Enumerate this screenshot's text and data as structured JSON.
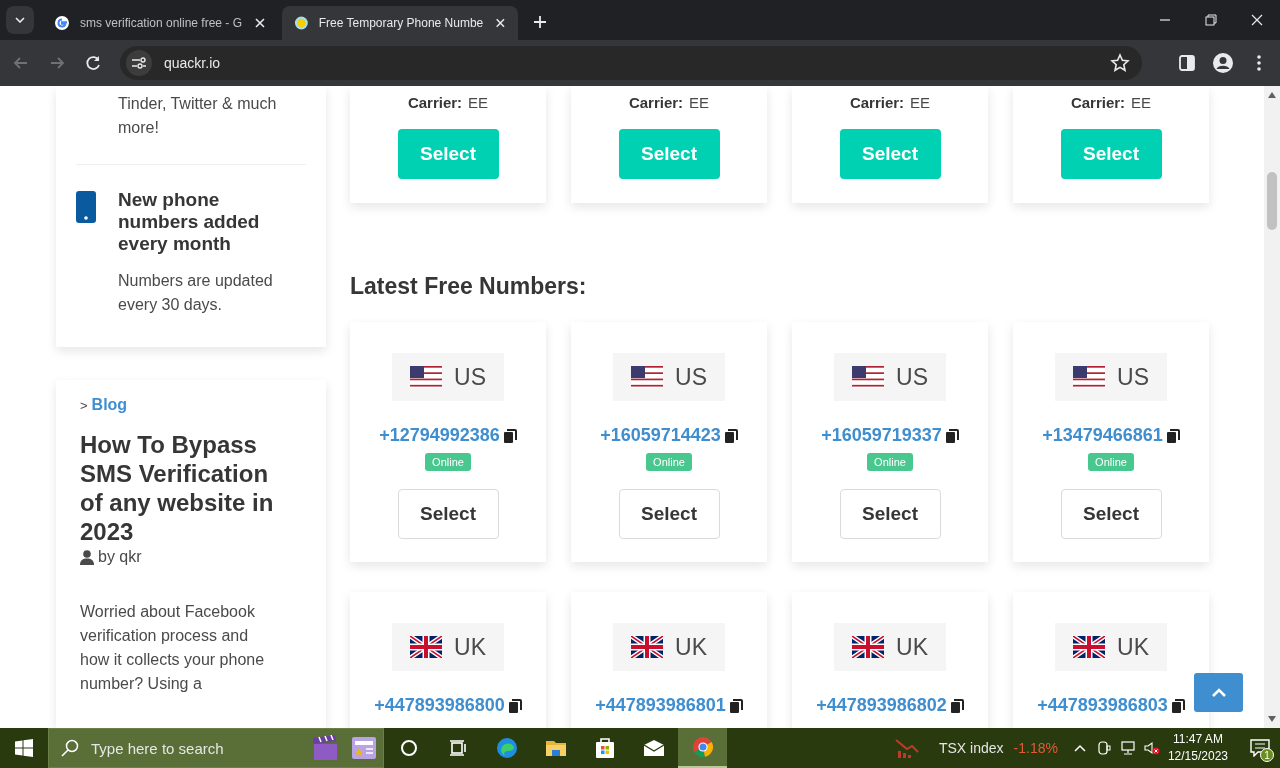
{
  "browser": {
    "tabs": [
      {
        "title": "sms verification online free - G",
        "kind": "google",
        "selected": false
      },
      {
        "title": "Free Temporary Phone Numbe",
        "kind": "duck",
        "selected": true
      }
    ],
    "address": "quackr.io"
  },
  "sidebar": {
    "features_card": {
      "text": "Tinder, Twitter & much more!",
      "feature": {
        "title": "New phone numbers added every month",
        "description": "Numbers are updated every 30 days."
      }
    },
    "blog_card": {
      "breadcrumb_separator": ">",
      "breadcrumb": "Blog",
      "title": "How To Bypass SMS Verification of any website in 2023",
      "author": "by qkr",
      "excerpt": "Worried about Facebook verification process and how it collects your phone number? Using a"
    }
  },
  "main": {
    "carrier_cards": [
      {
        "carrier_label": "Carrier:",
        "carrier": "EE",
        "button": "Select"
      },
      {
        "carrier_label": "Carrier:",
        "carrier": "EE",
        "button": "Select"
      },
      {
        "carrier_label": "Carrier:",
        "carrier": "EE",
        "button": "Select"
      },
      {
        "carrier_label": "Carrier:",
        "carrier": "EE",
        "button": "Select"
      }
    ],
    "section_title": "Latest Free Numbers:",
    "number_cards": [
      {
        "kind": "us",
        "country": "US",
        "number": "+12794992386",
        "status": "Online",
        "button": "Select"
      },
      {
        "kind": "us",
        "country": "US",
        "number": "+16059714423",
        "status": "Online",
        "button": "Select"
      },
      {
        "kind": "us",
        "country": "US",
        "number": "+16059719337",
        "status": "Online",
        "button": "Select"
      },
      {
        "kind": "us",
        "country": "US",
        "number": "+13479466861",
        "status": "Online",
        "button": "Select"
      },
      {
        "kind": "uk",
        "country": "UK",
        "number": "+447893986800"
      },
      {
        "kind": "uk",
        "country": "UK",
        "number": "+447893986801"
      },
      {
        "kind": "uk",
        "country": "UK",
        "number": "+447893986802"
      },
      {
        "kind": "uk",
        "country": "UK",
        "number": "+447893986803"
      }
    ]
  },
  "taskbar": {
    "search_placeholder": "Type here to search",
    "apps": [
      {
        "kind": "cortana",
        "selected": false
      },
      {
        "kind": "taskview",
        "selected": false
      },
      {
        "kind": "edge",
        "selected": false
      },
      {
        "kind": "folder",
        "selected": false
      },
      {
        "kind": "store",
        "selected": false
      },
      {
        "kind": "mail",
        "selected": false
      },
      {
        "kind": "chrome",
        "selected": true
      }
    ],
    "widget": {
      "name": "TSX index",
      "change": "-1.18%"
    },
    "time": "11:47 AM",
    "date": "12/15/2023",
    "notifications": "1"
  }
}
